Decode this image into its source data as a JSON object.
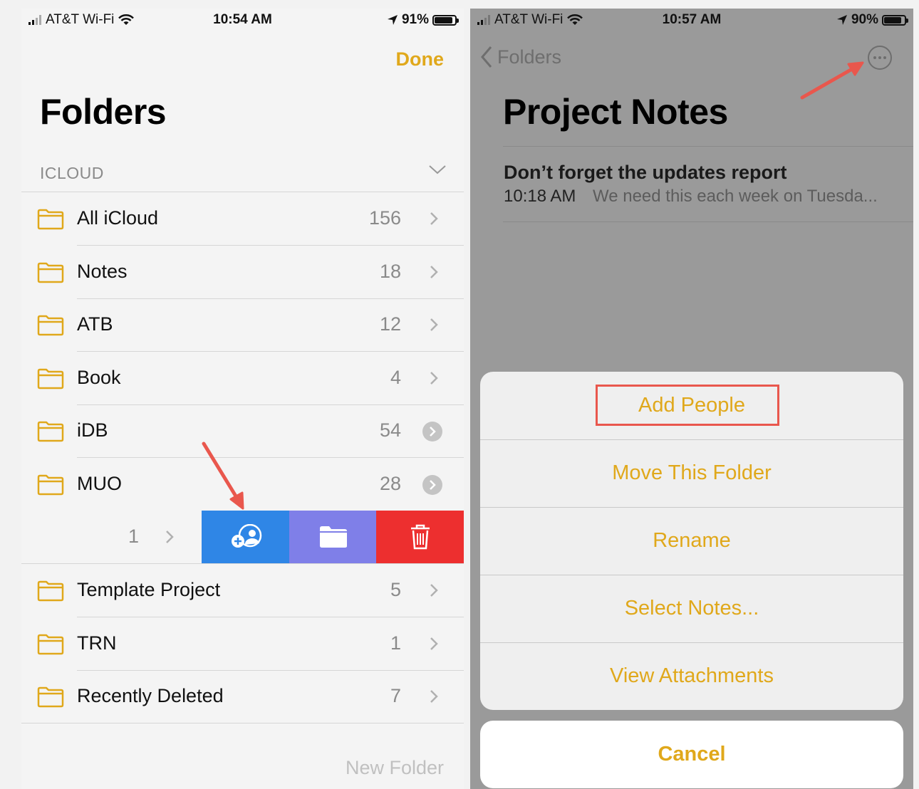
{
  "left": {
    "status": {
      "carrier": "AT&T Wi-Fi",
      "time": "10:54 AM",
      "battery": "91%",
      "battery_level": 0.91
    },
    "done_label": "Done",
    "title": "Folders",
    "section": "ICLOUD",
    "folders": [
      {
        "name": "All iCloud",
        "count": "156"
      },
      {
        "name": "Notes",
        "count": "18"
      },
      {
        "name": "ATB",
        "count": "12"
      },
      {
        "name": "Book",
        "count": "4"
      },
      {
        "name": "iDB",
        "count": "54"
      },
      {
        "name": "MUO",
        "count": "28"
      },
      {
        "name": "Template Project",
        "count": "5"
      },
      {
        "name": "TRN",
        "count": "1"
      },
      {
        "name": "Recently Deleted",
        "count": "7"
      }
    ],
    "swiped_count": "1",
    "new_folder_label": "New Folder",
    "actions": {
      "share_icon": "add-people-icon",
      "move_icon": "folder-icon",
      "delete_icon": "trash-icon"
    },
    "colors": {
      "share": "#2f86e6",
      "move": "#7f7fe8",
      "delete": "#ed2f2f"
    }
  },
  "right": {
    "status": {
      "carrier": "AT&T Wi-Fi",
      "time": "10:57 AM",
      "battery": "90%",
      "battery_level": 0.9
    },
    "back_label": "Folders",
    "more_icon": "ellipsis-circle-icon",
    "title": "Project Notes",
    "note": {
      "title": "Don’t forget the updates report",
      "time": "10:18 AM",
      "preview": "We need this each week on Tuesda..."
    },
    "menu": [
      "Add People",
      "Move This Folder",
      "Rename",
      "Select Notes...",
      "View Attachments"
    ],
    "cancel_label": "Cancel"
  },
  "colors": {
    "accent": "#e0a81b",
    "annotation": "#e9574d"
  }
}
